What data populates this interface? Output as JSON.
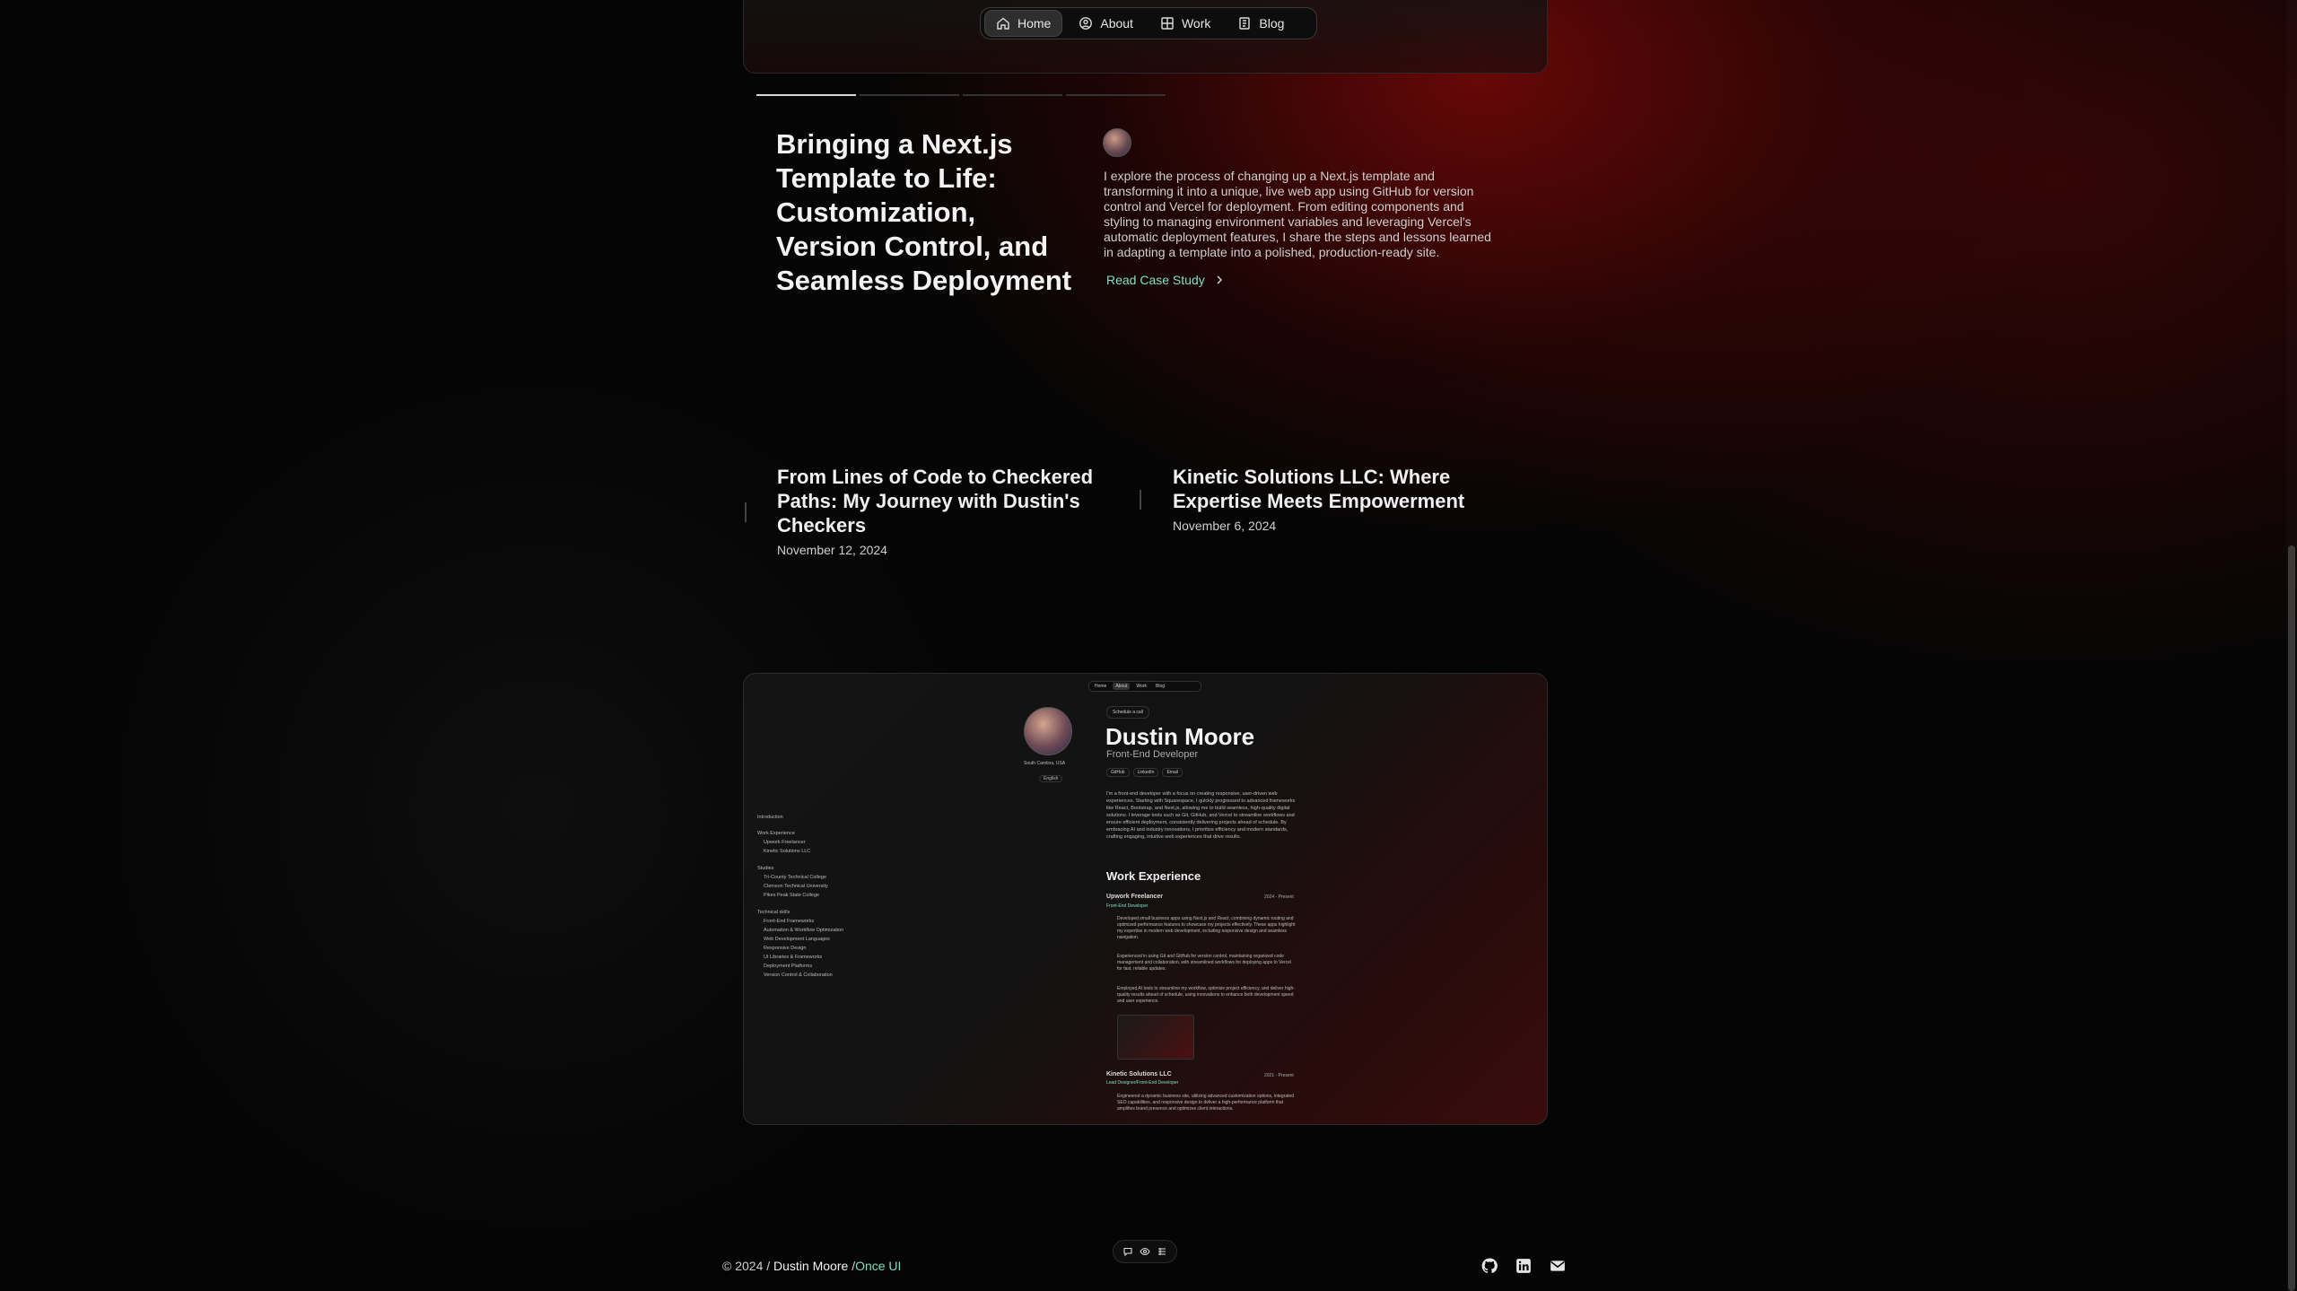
{
  "nav": {
    "items": [
      {
        "label": "Home",
        "icon": "home-icon",
        "active": true
      },
      {
        "label": "About",
        "icon": "person-icon",
        "active": false
      },
      {
        "label": "Work",
        "icon": "grid-icon",
        "active": false
      },
      {
        "label": "Blog",
        "icon": "book-icon",
        "active": false
      }
    ]
  },
  "featured": {
    "title": "Bringing a Next.js Template to Life: Customization, Version Control, and Seamless Deployment",
    "description": "I explore the process of changing up a Next.js template and transforming it into a unique, live web app using GitHub for version control and Vercel for deployment. From editing components and styling to managing environment variables and leveraging Vercel's automatic deployment features, I share the steps and lessons learned in adapting a template into a polished, production-ready site.",
    "link_label": "Read Case Study",
    "slides_total": 4,
    "slide_active": 1
  },
  "posts": [
    {
      "title": "From Lines of Code to Checkered Paths: My Journey with Dustin's Checkers",
      "date": "November 12, 2024"
    },
    {
      "title": "Kinetic Solutions LLC: Where Expertise Meets Empowerment",
      "date": "November 6, 2024"
    }
  ],
  "preview": {
    "nav": [
      "Home",
      "About",
      "Work",
      "Blog"
    ],
    "schedule": "Schedule a call",
    "name": "Dustin Moore",
    "role": "Front-End Developer",
    "location": "South Carolina, USA",
    "language": "English",
    "chips": [
      "GitHub",
      "LinkedIn",
      "Email"
    ],
    "bio": "I'm a front-end developer with a focus on creating responsive, user-driven web experiences. Starting with Squarespace, I quickly progressed to advanced frameworks like React, Bootstrap, and Next.js, allowing me to build seamless, high-quality digital solutions. I leverage tools such as Git, GitHub, and Vercel to streamline workflows and ensure efficient deployment, consistently delivering projects ahead of schedule. By embracing AI and industry innovations, I prioritize efficiency and modern standards, crafting engaging, intuitive web experiences that drive results.",
    "section_title": "Work Experience",
    "jobs": [
      {
        "company": "Upwork Freelancer",
        "role": "Front-End Developer",
        "dates": "2024 - Present"
      },
      {
        "company": "Kinetic Solutions LLC",
        "role": "Lead Designer/Front-End Developer",
        "dates": "2021 - Present"
      }
    ],
    "bullets": [
      "Developed small business apps using Next.js and React, combining dynamic routing and optimized performance features to showcase my projects effectively. These apps highlight my expertise in modern web development, including responsive design and seamless navigation.",
      "Experienced in using Git and GitHub for version control, maintaining organized code management and collaboration, with streamlined workflows for deploying apps to Vercel for fast, reliable updates.",
      "Employed AI tools to streamline my workflow, optimize project efficiency, and deliver high-quality results ahead of schedule, using innovations to enhance both development speed and user experience.",
      "Engineered a dynamic business site, utilizing advanced customization options, integrated SEO capabilities, and responsive design to deliver a high-performance platform that amplifies brand presence and optimizes client interactions."
    ],
    "toc": {
      "intro": "Introduction",
      "work": "Work Experience",
      "work_items": [
        "Upwork Freelancer",
        "Kinetic Solutions LLC"
      ],
      "studies": "Studies",
      "study_items": [
        "Tri-County Technical College",
        "Clemson Technical University",
        "Pikes Peak State College"
      ],
      "skills": "Technical skills",
      "skill_items": [
        "Front-End Frameworks",
        "Automation & Workflow Optimization",
        "Web Development Languages",
        "Responsive Design",
        "UI Libraries & Frameworks",
        "Deployment Platforms",
        "Version Control & Collaboration"
      ]
    }
  },
  "footer": {
    "year": "© 2024 /",
    "name": "Dustin Moore",
    "separator": "/",
    "link": "Once UI"
  },
  "colors": {
    "accent": "#7fe0c4",
    "background": "#050505",
    "glow": "#780808"
  }
}
